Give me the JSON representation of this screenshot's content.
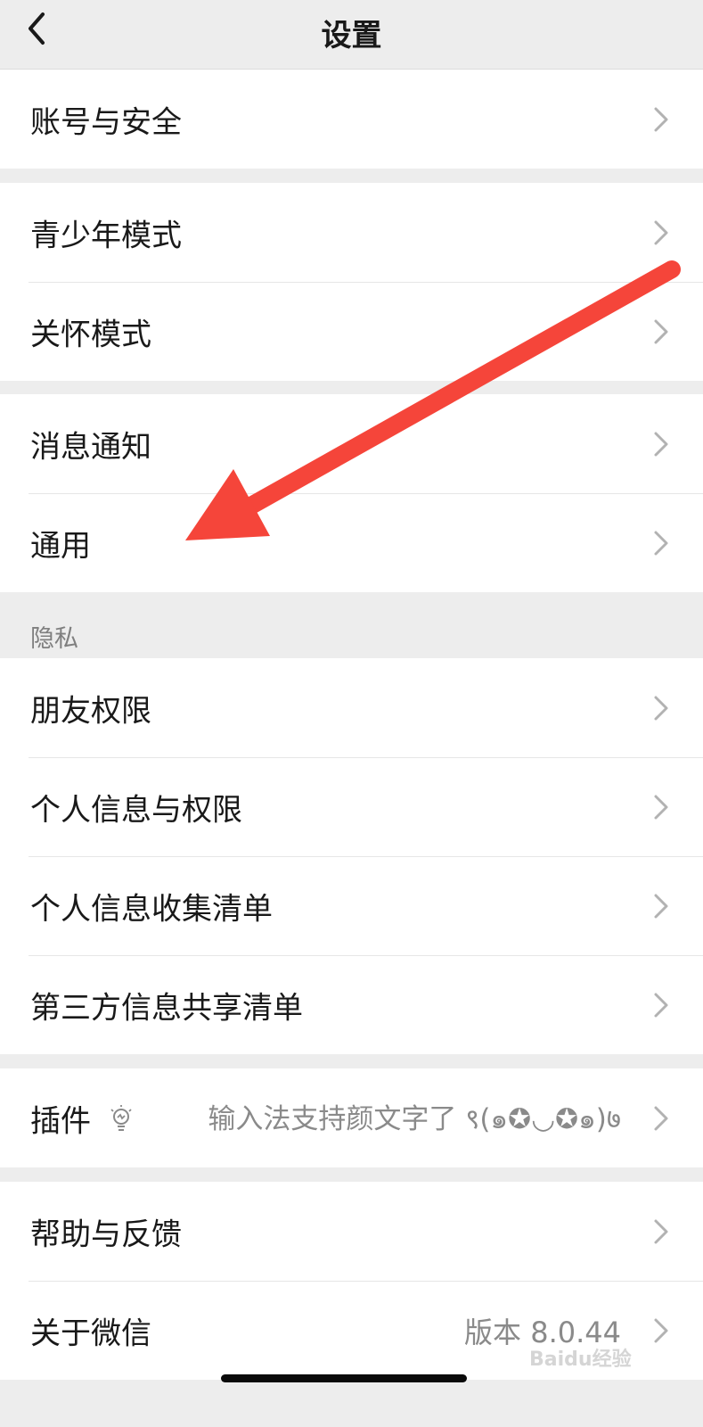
{
  "nav": {
    "title": "设置",
    "back_icon": "chevron-left-icon"
  },
  "groups": [
    {
      "items": [
        {
          "label": "账号与安全"
        }
      ]
    },
    {
      "items": [
        {
          "label": "青少年模式"
        },
        {
          "label": "关怀模式"
        }
      ]
    },
    {
      "items": [
        {
          "label": "消息通知"
        },
        {
          "label": "通用"
        }
      ]
    },
    {
      "header": "隐私",
      "items": [
        {
          "label": "朋友权限"
        },
        {
          "label": "个人信息与权限"
        },
        {
          "label": "个人信息收集清单"
        },
        {
          "label": "第三方信息共享清单"
        }
      ]
    },
    {
      "items": [
        {
          "label": "插件",
          "icon": "lightbulb-icon",
          "value": "输入法支持颜文字了 ९(๑✪◡✪๑)७"
        }
      ]
    },
    {
      "items": [
        {
          "label": "帮助与反馈"
        },
        {
          "label": "关于微信",
          "value": "版本 8.0.44"
        }
      ]
    }
  ],
  "annotation": {
    "type": "arrow",
    "color": "#f5453a",
    "points_to": "通用"
  },
  "watermark": "Baidu经验",
  "colors": {
    "background": "#ededed",
    "card": "#ffffff",
    "text": "#191919",
    "secondary": "#8a8a8a"
  }
}
